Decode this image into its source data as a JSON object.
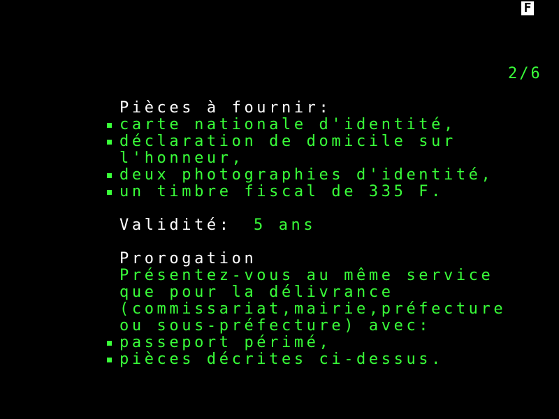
{
  "indicator": "F",
  "page_counter": "2/6",
  "pieces": {
    "heading": "Pièces à fournir:",
    "items": [
      "carte nationale d'identité,",
      "déclaration de domicile sur",
      "l'honneur,",
      "deux photographies d'identité,",
      "un timbre fiscal de 335 F."
    ]
  },
  "validite": {
    "label": "Validité:",
    "value": "5 ans"
  },
  "prorogation": {
    "heading": "Prorogation",
    "lines": [
      "Présentez-vous au même service",
      "que pour la délivrance",
      "(commissariat,mairie,préfecture",
      "ou sous-préfecture) avec:"
    ],
    "items": [
      "passeport périmé,",
      "pièces décrites ci-dessus."
    ]
  },
  "colors": {
    "background": "#000000",
    "text_primary": "#ffffff",
    "text_accent": "#39ff39"
  }
}
